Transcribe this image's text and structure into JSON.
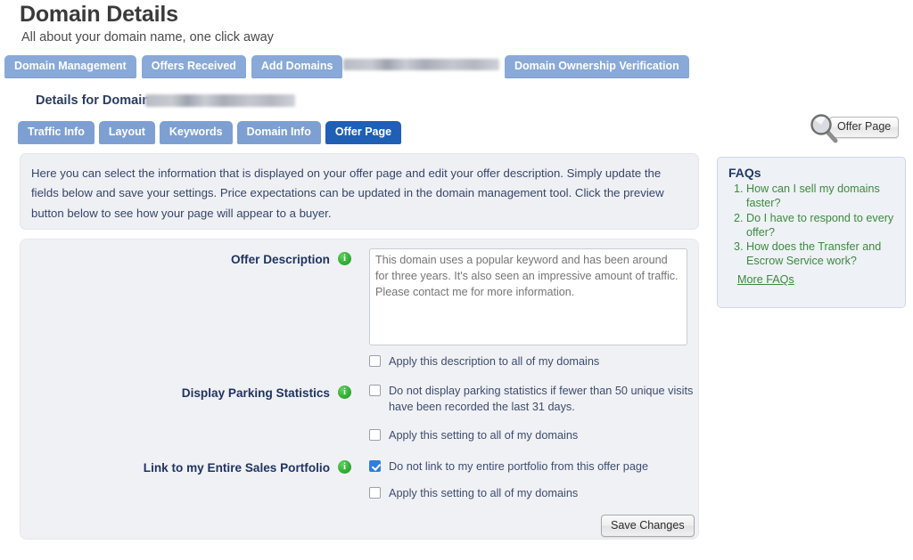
{
  "header": {
    "title": "Domain Details",
    "subtitle": "All about your domain name, one click away"
  },
  "top_nav": {
    "items": [
      {
        "label": "Domain Management",
        "active": false
      },
      {
        "label": "Offers Received",
        "active": false
      },
      {
        "label": "Add Domains",
        "active": false
      }
    ],
    "verification_tab": "Domain Ownership Verification"
  },
  "details": {
    "label": "Details for Domain"
  },
  "sub_nav": {
    "items": [
      {
        "label": "Traffic Info",
        "active": false
      },
      {
        "label": "Layout",
        "active": false
      },
      {
        "label": "Keywords",
        "active": false
      },
      {
        "label": "Domain Info",
        "active": false
      },
      {
        "label": "Offer Page",
        "active": true
      }
    ]
  },
  "preview": {
    "button_label": "Offer Page",
    "icon": "magnifier-icon"
  },
  "info_banner": {
    "text": "Here you can select the information that is displayed on your offer page and edit your offer description. Simply update the fields below and save your settings. Price expectations can be updated in the domain management tool. Click the preview button below to see how your page will appear to a buyer."
  },
  "faqs": {
    "title": "FAQs",
    "items": [
      "How can I sell my domains faster?",
      "Do I have to respond to every offer?",
      "How does the Transfer and Escrow Service work?"
    ],
    "more_link": "More FAQs"
  },
  "form": {
    "offer_description": {
      "label": "Offer Description",
      "info_icon": "info-icon",
      "value": "",
      "placeholder": "This domain uses a popular keyword and has been around for three years. It's also seen an impressive amount of traffic. Please contact me for more information.",
      "apply_all_label": "Apply this description to all of my domains",
      "apply_all_checked": false
    },
    "parking_statistics": {
      "label": "Display Parking Statistics",
      "info_icon": "info-icon",
      "option_label": "Do not display parking statistics if fewer than 50 unique visits have been recorded the last 31 days.",
      "option_checked": false,
      "apply_all_label": "Apply this setting to all of my domains",
      "apply_all_checked": false
    },
    "sales_portfolio": {
      "label": "Link to my Entire Sales Portfolio",
      "info_icon": "info-icon",
      "option_label": "Do not link to my entire portfolio from this offer page",
      "option_checked": true,
      "apply_all_label": "Apply this setting to all of my domains",
      "apply_all_checked": false
    },
    "save_button": "Save Changes"
  },
  "colors": {
    "tab_blue": "#89a9d8",
    "tab_active_blue": "#1f5fb5",
    "panel_bg": "#f0f1f5",
    "faq_green": "#3c8a3c",
    "label_navy": "#1f3461",
    "checkbox_checked": "#2b7fe0",
    "info_icon_green": "#34b034"
  }
}
